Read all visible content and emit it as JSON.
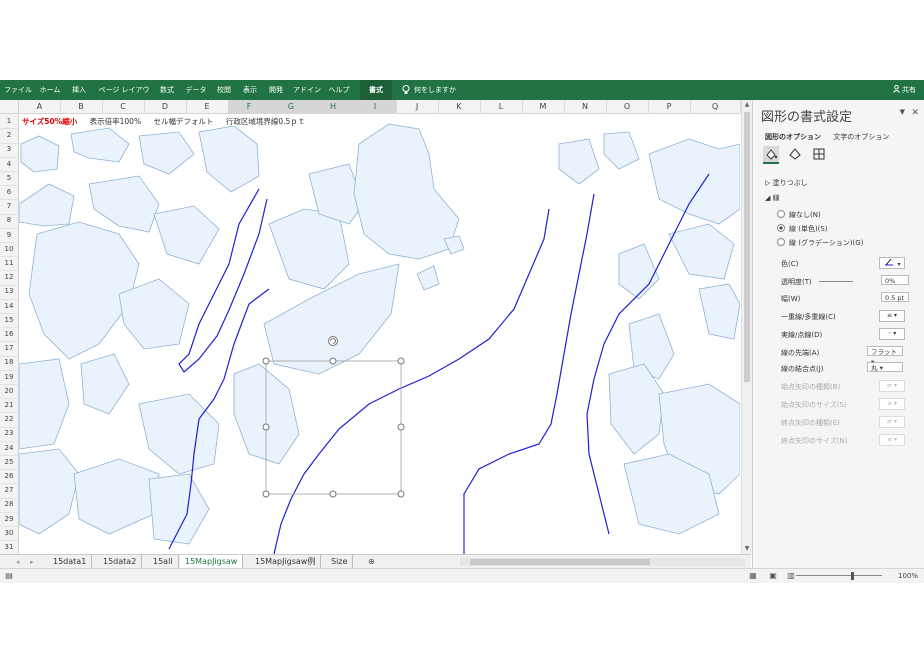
{
  "ribbon": {
    "tabs": [
      "ファイル",
      "ホーム",
      "挿入",
      "ページ レイアウト",
      "数式",
      "データ",
      "校閲",
      "表示",
      "開発",
      "アドイン",
      "ヘルプ",
      "書式"
    ],
    "active_tab": "書式",
    "tell_me": "何をしますか",
    "share": "共有"
  },
  "columns": [
    "A",
    "B",
    "C",
    "D",
    "E",
    "F",
    "G",
    "H",
    "I",
    "J",
    "K",
    "L",
    "M",
    "N",
    "O",
    "P",
    "Q"
  ],
  "selected_columns": [
    "F",
    "G",
    "H",
    "I"
  ],
  "rows": [
    "1",
    "2",
    "3",
    "4",
    "5",
    "6",
    "7",
    "8",
    "9",
    "10",
    "11",
    "12",
    "13",
    "14",
    "15",
    "16",
    "17",
    "18",
    "19",
    "20",
    "21",
    "22",
    "23",
    "24",
    "25",
    "26",
    "27",
    "28",
    "29",
    "30",
    "31"
  ],
  "row1": {
    "note_red": "サイズ50%縮小",
    "note1": "表示倍率100%",
    "note2": "セル幅デフォルト",
    "note3": "行政区域境界線0.5ｐｔ"
  },
  "sheets": {
    "tabs": [
      "15data1",
      "15data2",
      "15all",
      "15MapJigsaw",
      "15MapJigsaw例",
      "Size"
    ],
    "active": "15MapJigsaw",
    "nav_prev": "◂",
    "nav_next": "▸",
    "add": "⊕"
  },
  "status": {
    "zoom": "100%"
  },
  "pane": {
    "title": "図形の書式設定",
    "tab_shape": "図形のオプション",
    "tab_text": "文字のオプション",
    "fill_section": "塗りつぶし",
    "line_section": "線",
    "line_none": "線なし(N)",
    "line_solid": "線 (単色)(S)",
    "line_gradient": "線 (グラデーション)(G)",
    "color_label": "色(C)",
    "transparency_label": "透明度(T)",
    "transparency_value": "0%",
    "width_label": "幅(W)",
    "width_value": "0.5 pt",
    "compound_label": "一重線/多重線(C)",
    "dash_label": "実線/点線(D)",
    "cap_label": "線の先端(A)",
    "cap_value": "フラット",
    "join_label": "線の結合点(J)",
    "join_value": "丸",
    "begin_arrow_type": "始点矢印の種類(B)",
    "begin_arrow_size": "始点矢印のサイズ(S)",
    "end_arrow_type": "終点矢印の種類(E)",
    "end_arrow_size": "終点矢印のサイズ(N)"
  },
  "colors": {
    "excel_green": "#217346",
    "map_fill": "#eaf2fb",
    "map_stroke": "#8fb3d6",
    "boundary": "#1f1fd6"
  },
  "icons": [
    "lightbulb-icon",
    "person-icon",
    "fill-line-icon",
    "effects-icon",
    "size-properties-icon",
    "close-icon",
    "chevron-down-icon"
  ]
}
